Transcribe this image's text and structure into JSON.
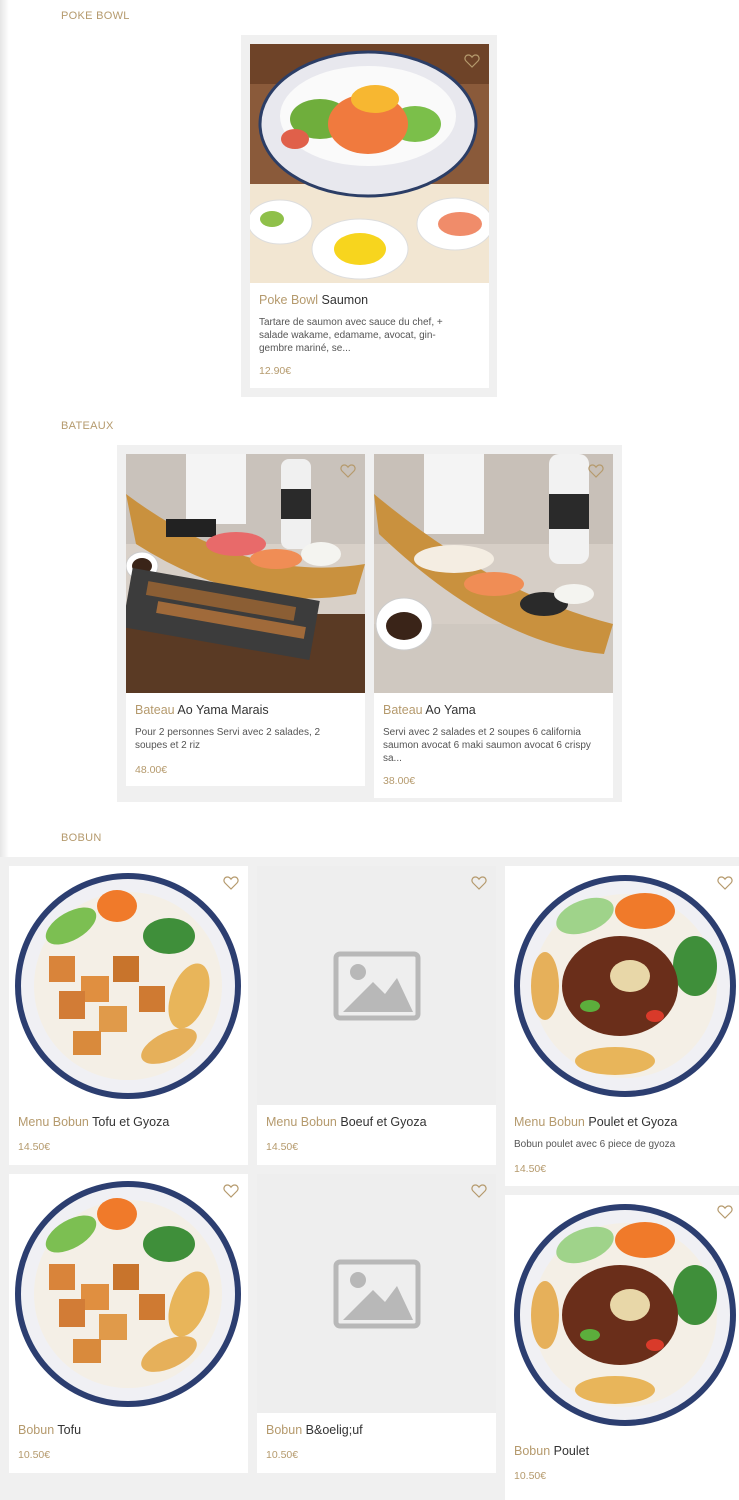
{
  "sections": [
    {
      "title": "POKE BOWL",
      "items": [
        {
          "category": "Poke Bowl",
          "name": "Saumon",
          "description": "Tartare de saumon avec sauce du chef, + salade wakame, edamame, avocat, gin-gembre mariné, se...",
          "price": "12.90€",
          "image": "poke-bowl-photo"
        }
      ]
    },
    {
      "title": "BATEAUX",
      "items": [
        {
          "category": "Bateau",
          "name": "Ao Yama Marais",
          "description": "Pour 2 personnes Servi avec 2 salades, 2 soupes et 2 riz",
          "price": "48.00€",
          "image": "sushi-boat-photo"
        },
        {
          "category": "Bateau",
          "name": "Ao Yama",
          "description": "Servi avec 2 salades et 2 soupes 6 california saumon avocat 6 maki saumon avocat 6 crispy sa...",
          "price": "38.00€",
          "image": "sushi-boat-photo"
        }
      ]
    },
    {
      "title": "BOBUN",
      "items": [
        {
          "category": "Menu Bobun",
          "name": "Tofu et Gyoza",
          "description": "",
          "price": "14.50€",
          "image": "bobun-tofu-photo"
        },
        {
          "category": "Menu Bobun",
          "name": "Boeuf et Gyoza",
          "description": "",
          "price": "14.50€",
          "image": "image-placeholder-icon"
        },
        {
          "category": "Menu Bobun",
          "name": "Poulet et Gyoza",
          "description": "Bobun poulet avec 6 piece de gyoza",
          "price": "14.50€",
          "image": "bobun-poulet-photo"
        },
        {
          "category": "Bobun",
          "name": "Tofu",
          "description": "",
          "price": "10.50€",
          "image": "bobun-tofu-photo"
        },
        {
          "category": "Bobun",
          "name": "B&oelig;uf",
          "description": "",
          "price": "10.50€",
          "image": "image-placeholder-icon"
        },
        {
          "category": "Bobun",
          "name": "Poulet",
          "description": "",
          "price": "10.50€",
          "image": "bobun-poulet-photo"
        }
      ]
    }
  ],
  "colors": {
    "accent": "#b59a6d",
    "panel": "#f0f0f0",
    "placeholder": "#eeeeee"
  }
}
